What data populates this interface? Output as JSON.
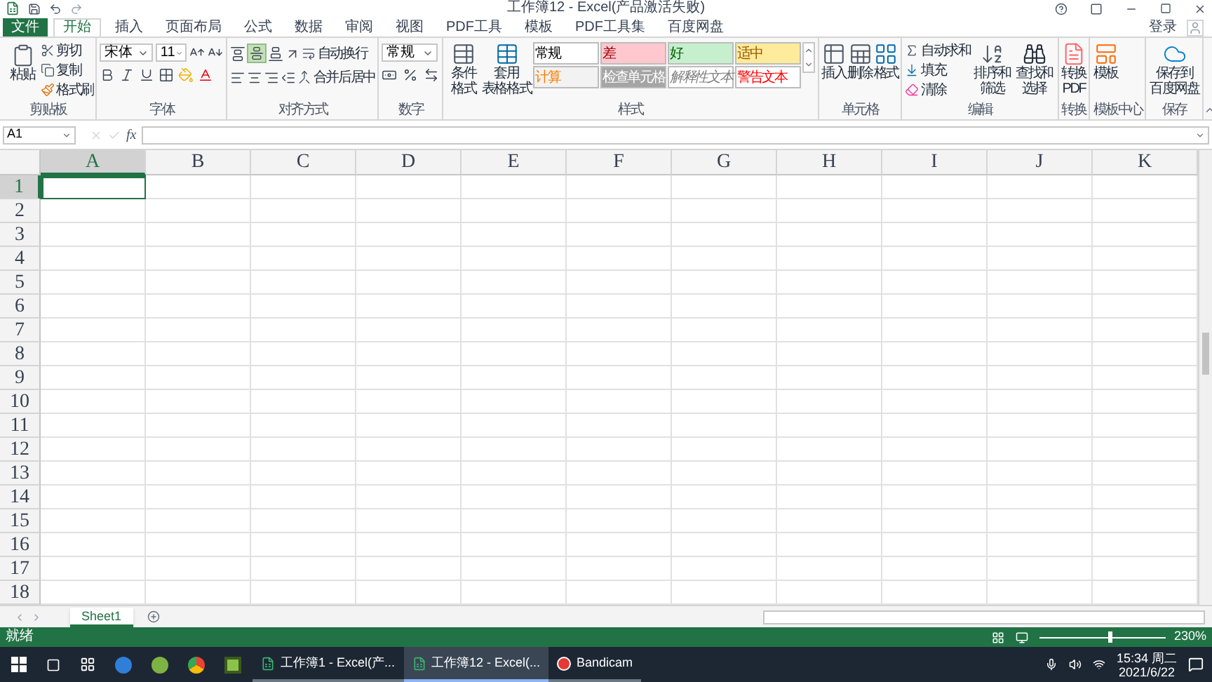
{
  "title_bar": {
    "title": "工作簿12 - Excel(产品激活失败)",
    "login": "登录"
  },
  "tabs": [
    {
      "label": "文件",
      "kind": "file",
      "selected": false
    },
    {
      "label": "开始",
      "kind": "tab",
      "selected": true
    },
    {
      "label": "插入",
      "kind": "tab",
      "selected": false
    },
    {
      "label": "页面布局",
      "kind": "tab",
      "selected": false
    },
    {
      "label": "公式",
      "kind": "tab",
      "selected": false
    },
    {
      "label": "数据",
      "kind": "tab",
      "selected": false
    },
    {
      "label": "审阅",
      "kind": "tab",
      "selected": false
    },
    {
      "label": "视图",
      "kind": "tab",
      "selected": false
    },
    {
      "label": "PDF工具",
      "kind": "tab",
      "selected": false
    },
    {
      "label": "模板",
      "kind": "tab",
      "selected": false
    },
    {
      "label": "PDF工具集",
      "kind": "tab",
      "selected": false
    },
    {
      "label": "百度网盘",
      "kind": "tab",
      "selected": false
    }
  ],
  "ribbon": {
    "clipboard": {
      "label": "剪贴板",
      "paste": "粘贴",
      "cut": "剪切",
      "copy": "复制",
      "format_painter": "格式刷"
    },
    "font": {
      "label": "字体",
      "font_name": "宋体",
      "font_size": "11"
    },
    "alignment": {
      "label": "对齐方式",
      "wrap_text": "自动换行",
      "merge_center": "合并后居中",
      "vertical_center": true
    },
    "number": {
      "label": "数字",
      "format": "常规"
    },
    "styles": {
      "label": "样式",
      "conditional_format": "条件格式",
      "table_format": [
        "套用",
        "表格格式"
      ],
      "cells": [
        {
          "label": "常规",
          "kind": "normal"
        },
        {
          "label": "差",
          "kind": "bad"
        },
        {
          "label": "好",
          "kind": "good"
        },
        {
          "label": "适中",
          "kind": "neutral"
        },
        {
          "label": "计算",
          "kind": "calculation"
        },
        {
          "label": "检查单元格",
          "kind": "check"
        },
        {
          "label": "解释性文本",
          "kind": "explanatory"
        },
        {
          "label": "警告文本",
          "kind": "warning"
        }
      ]
    },
    "cells": {
      "label": "单元格",
      "insert": "插入",
      "delete": "删除",
      "format": "格式"
    },
    "editing": {
      "label": "编辑",
      "autosum": "自动求和",
      "fill": "填充",
      "clear": "清除",
      "sort_filter": "排序和筛选",
      "find_select": "查找和选择"
    },
    "convert": {
      "label": "转换",
      "button": [
        "转换",
        "PDF"
      ]
    },
    "template": {
      "label": "模板中心",
      "button": "模板"
    },
    "save": {
      "label": "保存",
      "button": [
        "保存到",
        "百度网盘"
      ]
    }
  },
  "formula_bar": {
    "name_box": "A1",
    "function_label": "fx"
  },
  "columns": [
    {
      "label": "A",
      "selected": true
    },
    {
      "label": "B",
      "selected": false
    },
    {
      "label": "C",
      "selected": false
    },
    {
      "label": "D",
      "selected": false
    },
    {
      "label": "E",
      "selected": false
    },
    {
      "label": "F",
      "selected": false
    },
    {
      "label": "G",
      "selected": false
    },
    {
      "label": "H",
      "selected": false
    },
    {
      "label": "I",
      "selected": false
    },
    {
      "label": "J",
      "selected": false
    },
    {
      "label": "K",
      "selected": false
    }
  ],
  "rows": [
    {
      "label": "1",
      "selected": true
    },
    {
      "label": "2",
      "selected": false
    },
    {
      "label": "3",
      "selected": false
    },
    {
      "label": "4",
      "selected": false
    },
    {
      "label": "5",
      "selected": false
    },
    {
      "label": "6",
      "selected": false
    },
    {
      "label": "7",
      "selected": false
    },
    {
      "label": "8",
      "selected": false
    },
    {
      "label": "9",
      "selected": false
    },
    {
      "label": "10",
      "selected": false
    },
    {
      "label": "11",
      "selected": false
    },
    {
      "label": "12",
      "selected": false
    },
    {
      "label": "13",
      "selected": false
    },
    {
      "label": "14",
      "selected": false
    },
    {
      "label": "15",
      "selected": false
    },
    {
      "label": "16",
      "selected": false
    },
    {
      "label": "17",
      "selected": false
    },
    {
      "label": "18",
      "selected": false
    }
  ],
  "sheet_tabs": [
    {
      "label": "Sheet1",
      "selected": true
    }
  ],
  "status_bar": {
    "status": "就绪",
    "zoom": "230%",
    "zoom_slider": {
      "level": 0.56
    }
  },
  "taskbar": {
    "windows": [
      {
        "label": "工作簿1 - Excel(产...",
        "kind": "excel",
        "selected": false
      },
      {
        "label": "工作簿12 - Excel(...",
        "kind": "excel",
        "selected": true
      },
      {
        "label": "Bandicam",
        "kind": "recorder",
        "selected": false
      }
    ],
    "time": "15:34 周二",
    "date": "2021/6/22"
  }
}
